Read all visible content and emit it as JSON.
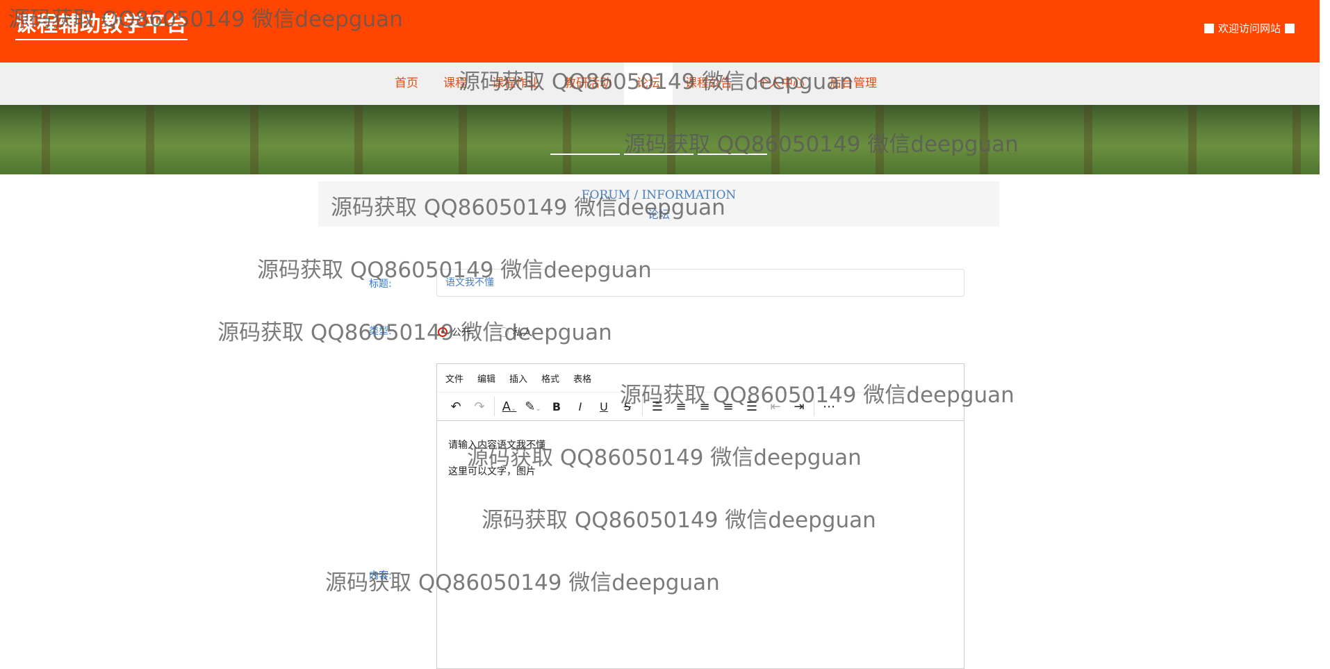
{
  "header": {
    "brand": "课程辅助教学平台",
    "welcome": "欢迎访问网站"
  },
  "nav": {
    "items": [
      {
        "label": "首页"
      },
      {
        "label": "课程"
      },
      {
        "label": "课程作业"
      },
      {
        "label": "教研活动"
      },
      {
        "label": "论坛",
        "active": true
      },
      {
        "label": "课程公告"
      },
      {
        "label": "个人中心"
      },
      {
        "label": "后台管理"
      }
    ]
  },
  "section": {
    "title_en": "FORUM / INFORMATION",
    "title_cn": "论坛"
  },
  "form": {
    "title_label": "标题:",
    "title_value": "语文我不懂",
    "type_label": "类型:",
    "type_options": [
      {
        "label": "公开",
        "selected": true
      },
      {
        "label": "私人",
        "selected": false
      }
    ],
    "content_label": "内容:",
    "editor": {
      "menu": [
        "文件",
        "编辑",
        "插入",
        "格式",
        "表格"
      ],
      "toolbar_icons": [
        "undo-icon",
        "redo-icon",
        "font-color-icon",
        "highlight-icon",
        "bold-icon",
        "italic-icon",
        "underline-icon",
        "strikethrough-icon",
        "line-height-icon",
        "align-left-icon",
        "align-center-icon",
        "align-right-icon",
        "align-justify-icon",
        "outdent-icon",
        "indent-icon",
        "more-icon"
      ],
      "line1": "请输入内容语文我不懂",
      "line2": "这里可以文字，图片"
    }
  },
  "watermark_text": "源码获取 QQ86050149 微信deepguan",
  "colors": {
    "header_bg": "#ff4500",
    "nav_text": "#e0501a",
    "link_blue": "#2b7bd0",
    "radio_red": "#d81e06"
  }
}
